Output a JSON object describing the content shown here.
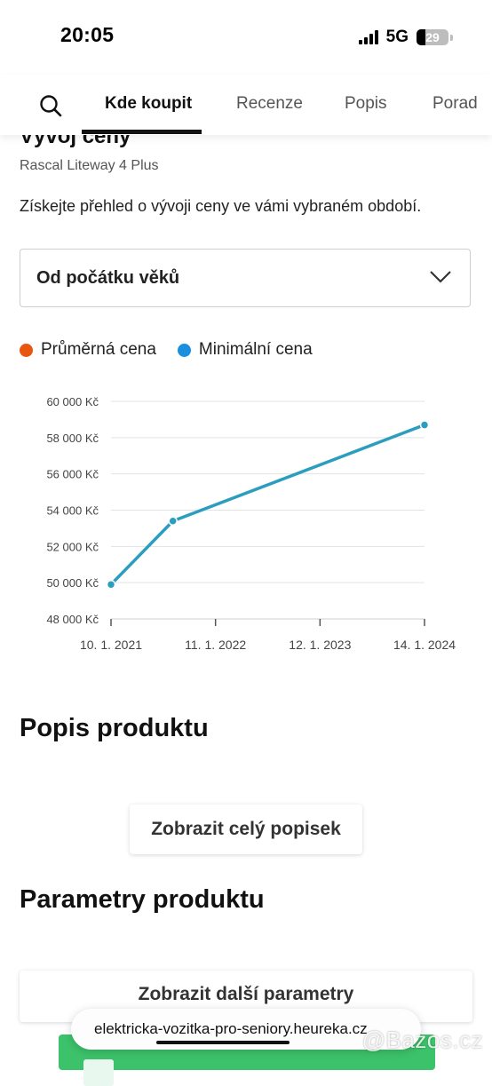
{
  "status_bar": {
    "time": "20:05",
    "network": "5G",
    "battery": "29",
    "battery_level": 0.29
  },
  "tabs": [
    {
      "label": "Kde koupit",
      "active": true
    },
    {
      "label": "Recenze",
      "active": false
    },
    {
      "label": "Popis",
      "active": false
    },
    {
      "label": "Porad",
      "active": false
    }
  ],
  "price_history": {
    "title": "Vývoj ceny",
    "product_name": "Rascal Liteway 4 Plus",
    "lead": "Získejte přehled o vývoji ceny ve vámi vybraném období.",
    "period_select": "Od počátku věků",
    "legend": [
      {
        "label": "Průměrná cena",
        "color": "#e8560f"
      },
      {
        "label": "Minimální cena",
        "color": "#1a8fdf"
      }
    ]
  },
  "chart_data": {
    "type": "line",
    "ylim": [
      48000,
      60000
    ],
    "y_ticks": [
      "60 000 Kč",
      "58 000 Kč",
      "56 000 Kč",
      "54 000 Kč",
      "52 000 Kč",
      "50 000 Kč",
      "48 000 Kč"
    ],
    "x_ticks": [
      "10. 1. 2021",
      "11. 1. 2022",
      "12. 1. 2023",
      "14. 1. 2024"
    ],
    "grid": true,
    "series": [
      {
        "name": "Minimální cena",
        "color": "#2b9ebf",
        "points": [
          {
            "x": "2021-01-10",
            "y": 49900
          },
          {
            "x": "2021-08-15",
            "y": 53400
          },
          {
            "x": "2024-01-14",
            "y": 58700
          }
        ]
      }
    ]
  },
  "description": {
    "title": "Popis produktu",
    "button": "Zobrazit celý popisek"
  },
  "parameters": {
    "title": "Parametry produktu",
    "button": "Zobrazit další parametry"
  },
  "browser": {
    "url": "elektricka-vozitka-pro-seniory.heureka.cz"
  },
  "watermark": "@Bazos.cz"
}
